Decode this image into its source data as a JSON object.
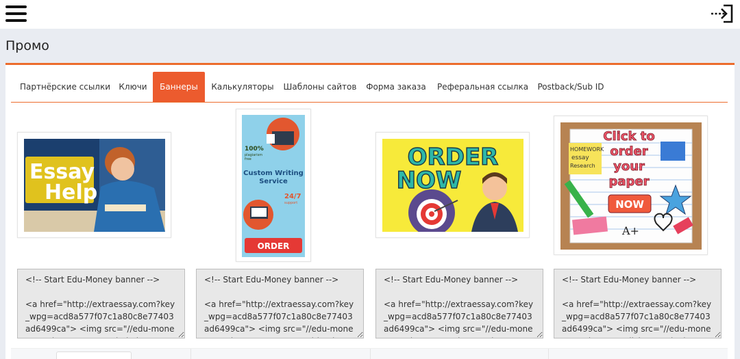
{
  "header": {
    "menu_icon": "hamburger-icon",
    "logout_icon": "logout-arrow-icon"
  },
  "page": {
    "title": "Промо"
  },
  "tabs": [
    {
      "label": "Партнёрские ссылки",
      "active": false
    },
    {
      "label": "Ключи",
      "active": false
    },
    {
      "label": "Баннеры",
      "active": true
    },
    {
      "label": "Калькуляторы",
      "active": false
    },
    {
      "label": "Шаблоны сайтов",
      "active": false
    },
    {
      "label": "Форма заказа",
      "active": false
    },
    {
      "label": "Реферальная ссылка",
      "active": false
    },
    {
      "label": "Postback/Sub ID",
      "active": false
    }
  ],
  "banners": [
    {
      "name": "essay-help",
      "text": [
        "Essay",
        "Help"
      ],
      "code": "<!-- Start Edu-Money banner -->\n\n<a href=\"http://extraessay.com?key_wpg=acd8a577f07c1a80c8e77403ad6499ca\"> <img src=\"//edu-money.com/banners/essay_help.jpg\" /></a>"
    },
    {
      "name": "custom-writing",
      "text": [
        "100%",
        "plagiarism",
        "free",
        "Custom Writing",
        "Service",
        "24/7",
        "support",
        "ORDER"
      ],
      "code": "<!-- Start Edu-Money banner -->\n\n<a href=\"http://extraessay.com?key_wpg=acd8a577f07c1a80c8e77403ad6499ca\"> <img src=\"//edu-money.com/banners/custom_writing.jpg\" /></a>"
    },
    {
      "name": "order-now",
      "text": [
        "ORDER",
        "NOW"
      ],
      "code": "<!-- Start Edu-Money banner -->\n\n<a href=\"http://extraessay.com?key_wpg=acd8a577f07c1a80c8e77403ad6499ca\"> <img src=\"//edu-money.com/banners/order_now.jpg\" /></a>"
    },
    {
      "name": "click-to-order",
      "text": [
        "Click to",
        "order",
        "your",
        "paper",
        "NOW",
        "HOMEWORK",
        "essay",
        "Research",
        "A+"
      ],
      "code": "<!-- Start Edu-Money banner -->\n\n<a href=\"http://extraessay.com?key_wpg=acd8a577f07c1a80c8e77403ad6499ca\"> <img src=\"//edu-money.com/banners/click_to_order.jpg\" /></a>"
    }
  ],
  "colors": {
    "accent": "#ec5b2e",
    "background": "#e9ecf2"
  }
}
